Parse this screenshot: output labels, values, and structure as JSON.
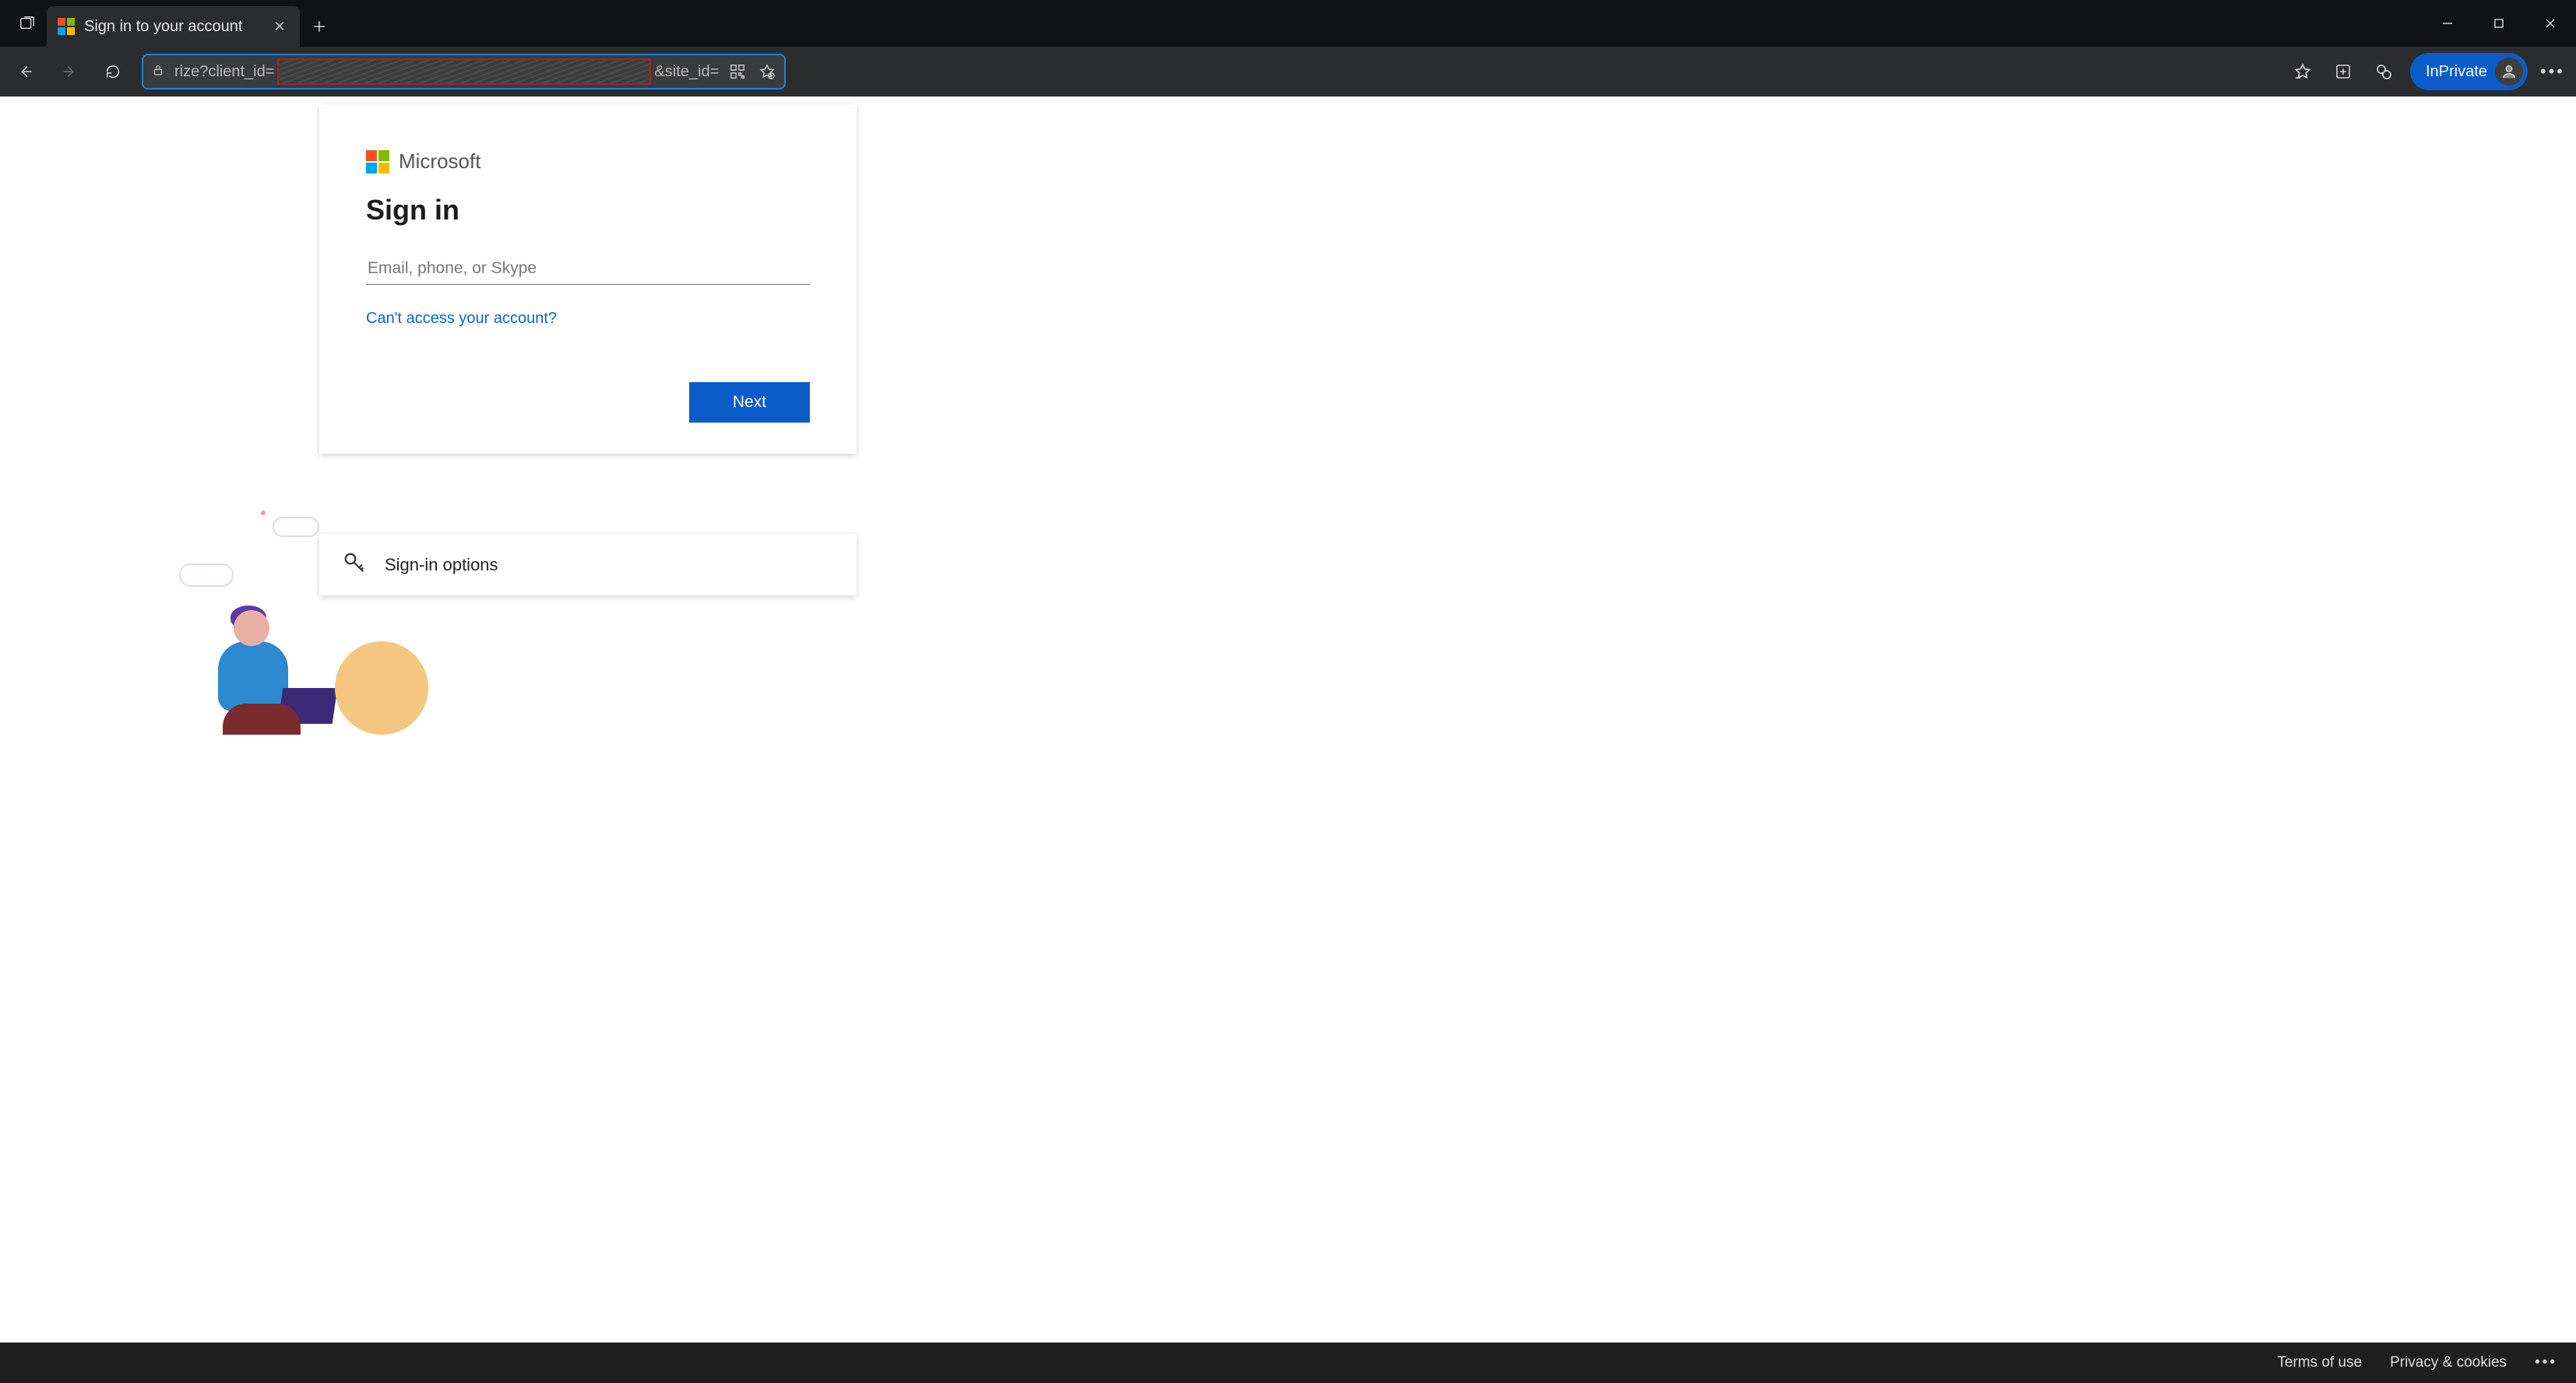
{
  "browser": {
    "tab_title": "Sign in to your account",
    "address": {
      "prefix": "rize?client_id=",
      "suffix": "&site_id="
    },
    "inprivate_label": "InPrivate"
  },
  "page": {
    "brand_name": "Microsoft",
    "heading": "Sign in",
    "input_placeholder": "Email, phone, or Skype",
    "help_link": "Can't access your account?",
    "next_button": "Next",
    "signin_options": "Sign-in options"
  },
  "footer": {
    "terms": "Terms of use",
    "privacy": "Privacy & cookies"
  }
}
